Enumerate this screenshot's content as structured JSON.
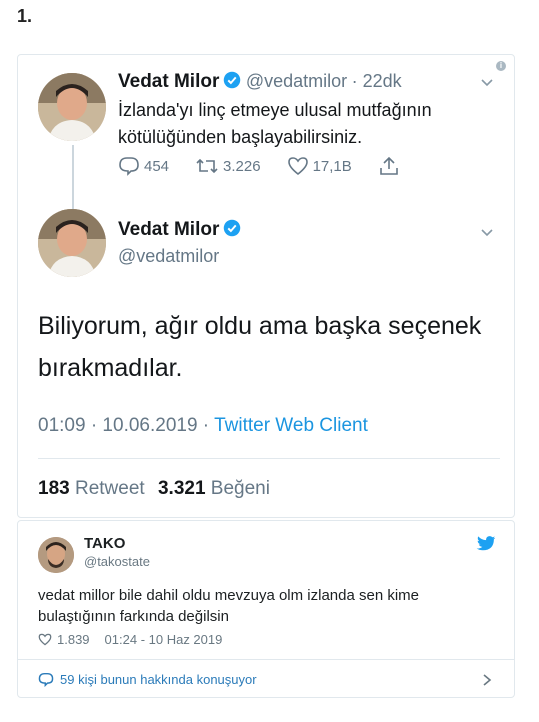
{
  "list_number": "1.",
  "tweet1": {
    "name": "Vedat Milor",
    "handle": "@vedatmilor",
    "time": "· 22dk",
    "text": "İzlanda'yı linç etmeye ulusal mutfağının kötülüğünden başlayabilirsiniz.",
    "replies": "454",
    "retweets": "3.226",
    "likes": "17,1B"
  },
  "tweet2": {
    "name": "Vedat Milor",
    "handle": "@vedatmilor",
    "text": "Biliyorum, ağır oldu ama başka seçenek bırakmadılar.",
    "datetime": "01:09 · 10.06.2019 ·",
    "client": "Twitter Web Client",
    "retweet_count": "183",
    "retweet_label": "Retweet",
    "like_count": "3.321",
    "like_label": "Beğeni"
  },
  "embed": {
    "name": "TAKO",
    "handle": "@takostate",
    "text": "vedat millor bile dahil oldu mevzuya olm izlanda sen kime bulaştığının farkında değilsin",
    "likes": "1.839",
    "datetime": "01:24 - 10 Haz 2019",
    "footer": "59 kişi bunun hakkında konuşuyor"
  },
  "colors": {
    "link": "#1b95e0",
    "verified": "#1da1f2",
    "muted": "#657786"
  }
}
